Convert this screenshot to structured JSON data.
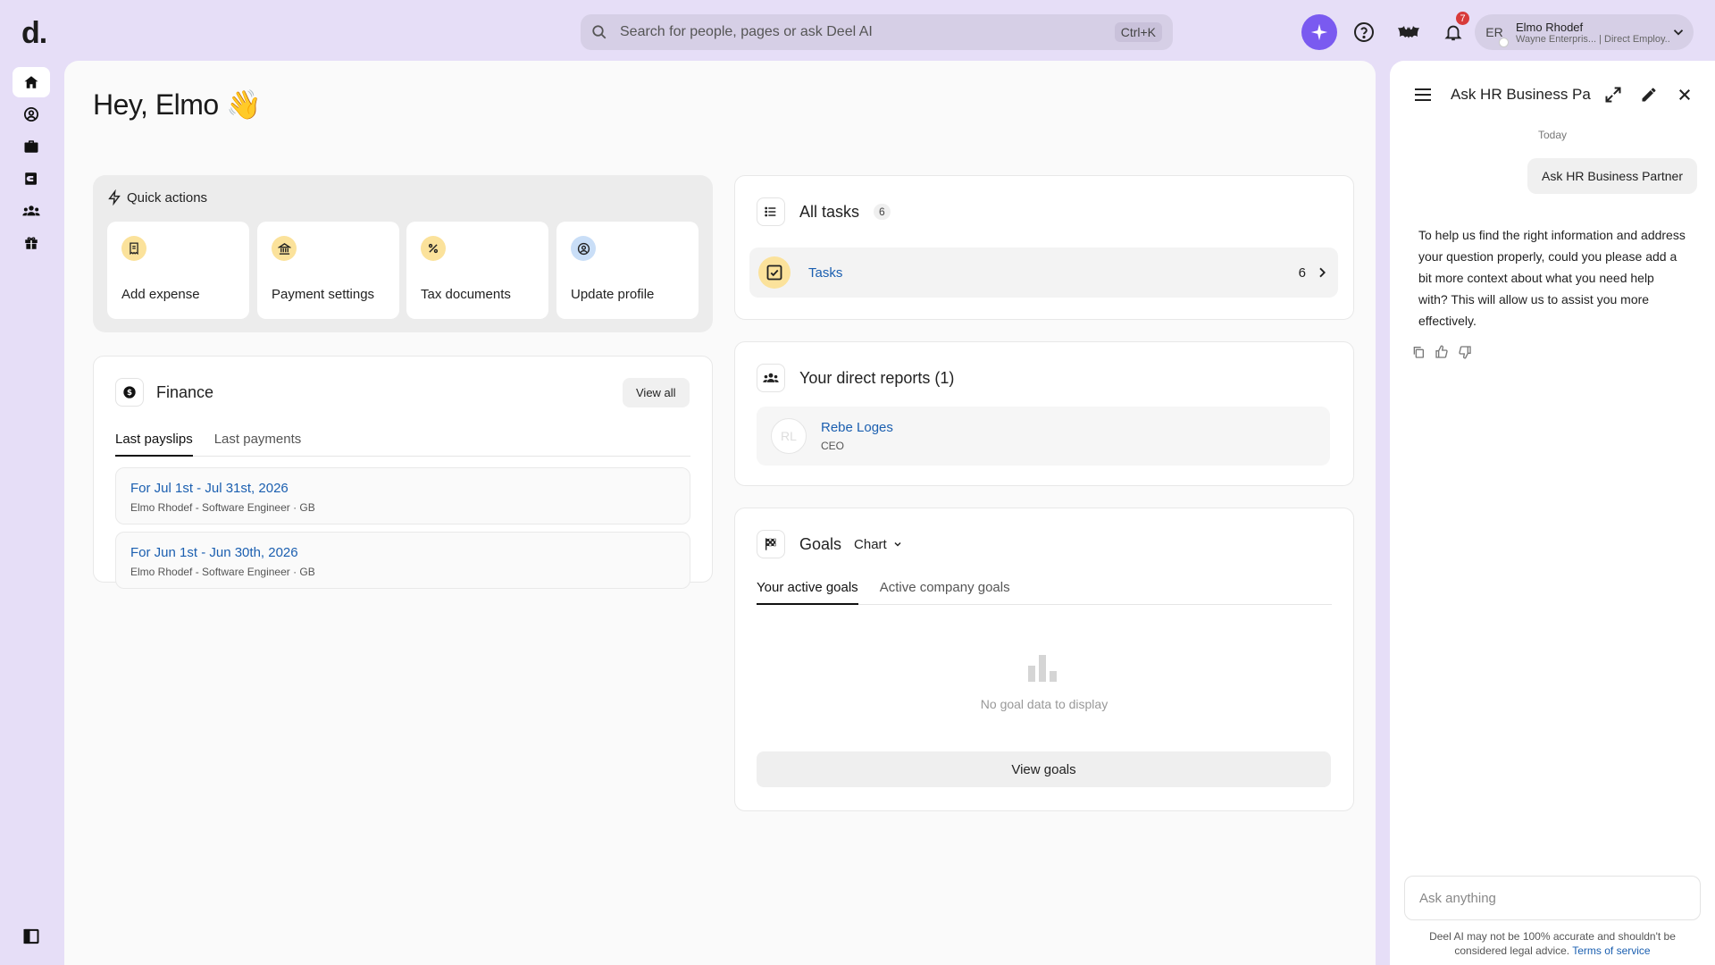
{
  "header": {
    "logo": "d.",
    "search_placeholder": "Search for people, pages or ask Deel AI",
    "search_shortcut": "Ctrl+K",
    "notification_count": "7",
    "user": {
      "initials": "ER",
      "name": "Elmo Rhodef",
      "subtitle": "Wayne Enterpris... | Direct Employ..."
    }
  },
  "greeting": "Hey, Elmo 👋",
  "quick_actions": {
    "title": "Quick actions",
    "items": [
      {
        "label": "Add expense",
        "icon": "receipt-icon"
      },
      {
        "label": "Payment settings",
        "icon": "bank-icon"
      },
      {
        "label": "Tax documents",
        "icon": "percent-icon"
      },
      {
        "label": "Update profile",
        "icon": "user-circle-icon"
      }
    ]
  },
  "finance": {
    "title": "Finance",
    "view_all": "View all",
    "tabs": [
      "Last payslips",
      "Last payments"
    ],
    "payslips": [
      {
        "title": "For Jul 1st - Jul 31st, 2026",
        "subtitle": "Elmo Rhodef - Software Engineer · GB"
      },
      {
        "title": "For Jun 1st - Jun 30th, 2026",
        "subtitle": "Elmo Rhodef - Software Engineer · GB"
      }
    ]
  },
  "tasks": {
    "title": "All tasks",
    "count": "6",
    "row_label": "Tasks",
    "row_count": "6"
  },
  "reports": {
    "title": "Your direct reports (1)",
    "people": [
      {
        "initials": "RL",
        "name": "Rebe Loges",
        "role": "CEO"
      }
    ]
  },
  "goals": {
    "title": "Goals",
    "view_mode": "Chart",
    "tabs": [
      "Your active goals",
      "Active company goals"
    ],
    "empty_text": "No goal data to display",
    "button": "View goals"
  },
  "chat": {
    "title": "Ask HR Business Part...",
    "day": "Today",
    "user_message": "Ask HR Business Partner",
    "ai_message": "To help us find the right information and address your question properly, could you please add a bit more context about what you need help with? This will allow us to assist you more effectively.",
    "input_placeholder": "Ask anything",
    "disclaimer": "Deel AI may not be 100% accurate and shouldn't be considered legal advice.",
    "terms_link": "Terms of service"
  },
  "colors": {
    "background": "#e6def7",
    "ai_accent": "#7a5af0",
    "link": "#1b5fb0",
    "icon_yellow": "#fbe29b"
  }
}
